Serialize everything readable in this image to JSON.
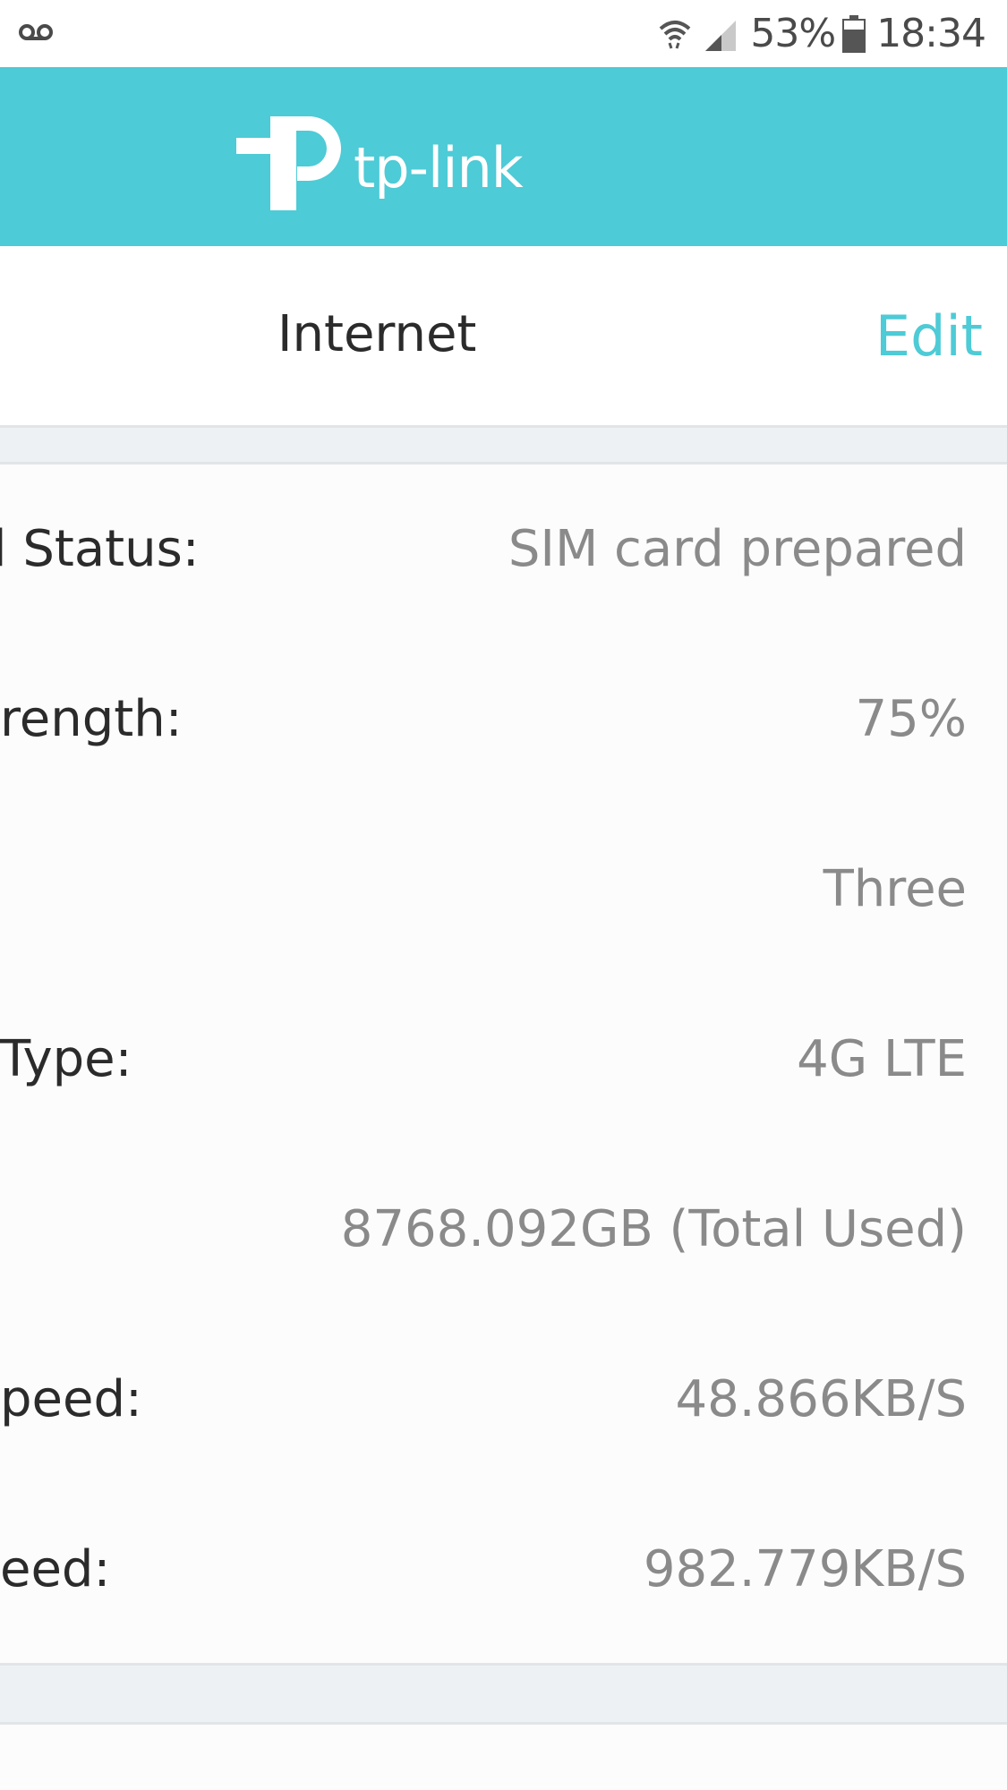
{
  "status_bar": {
    "battery_percent": "53%",
    "time": "18:34",
    "icons": [
      "voicemail-icon",
      "wifi-icon",
      "cell-signal-icon",
      "battery-icon"
    ]
  },
  "header": {
    "brand": "tp-link",
    "background": "#4dcbd6"
  },
  "title_bar": {
    "title": "Internet",
    "edit_label": "Edit",
    "accent": "#4dcbd6"
  },
  "details": [
    {
      "label": "l Status:",
      "value": "SIM card prepared"
    },
    {
      "label": "rength:",
      "value": "75%"
    },
    {
      "label": "",
      "value": "Three"
    },
    {
      "label": "Type:",
      "value": "4G LTE"
    },
    {
      "label": "",
      "value": "8768.092GB (Total Used)"
    },
    {
      "label": "peed:",
      "value": "48.866KB/S"
    },
    {
      "label": "eed:",
      "value": "982.779KB/S"
    }
  ]
}
